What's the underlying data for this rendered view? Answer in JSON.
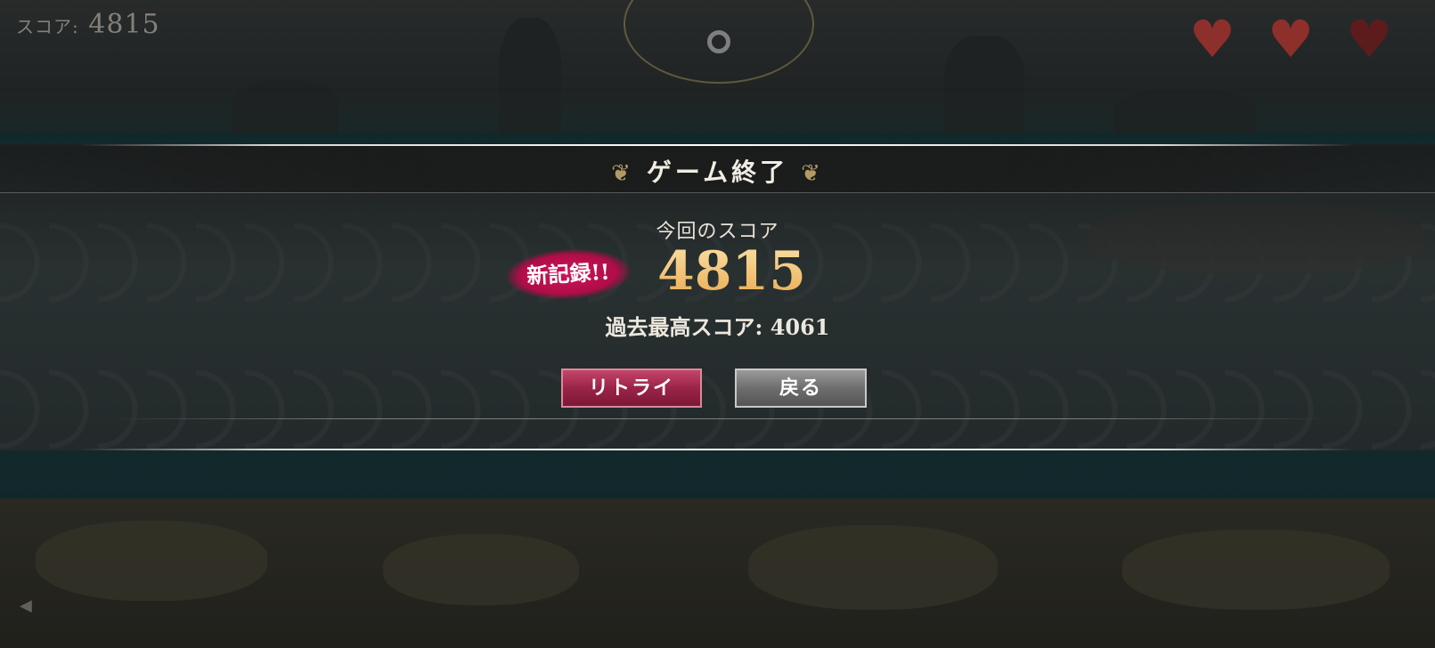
{
  "hud": {
    "score_label": "スコア:",
    "score_value": "4815",
    "hearts": [
      {
        "icon": "heart-icon",
        "state": "full"
      },
      {
        "icon": "heart-icon",
        "state": "full"
      },
      {
        "icon": "heart-icon",
        "state": "empty"
      }
    ],
    "pause_icon": "pause-icon",
    "emblem_icon": "eye-emblem-icon"
  },
  "dialog": {
    "title": "ゲーム終了",
    "current_score_label": "今回のスコア",
    "new_record_badge": "新記録!!",
    "current_score": "4815",
    "best_score_text": "過去最高スコア: 4061",
    "buttons": {
      "retry": "リトライ",
      "back": "戻る"
    }
  },
  "colors": {
    "score_gold": "#f0c070",
    "badge_magenta": "#c8124f",
    "retry_button": "#9a2448",
    "back_button": "#6e6e6e"
  }
}
